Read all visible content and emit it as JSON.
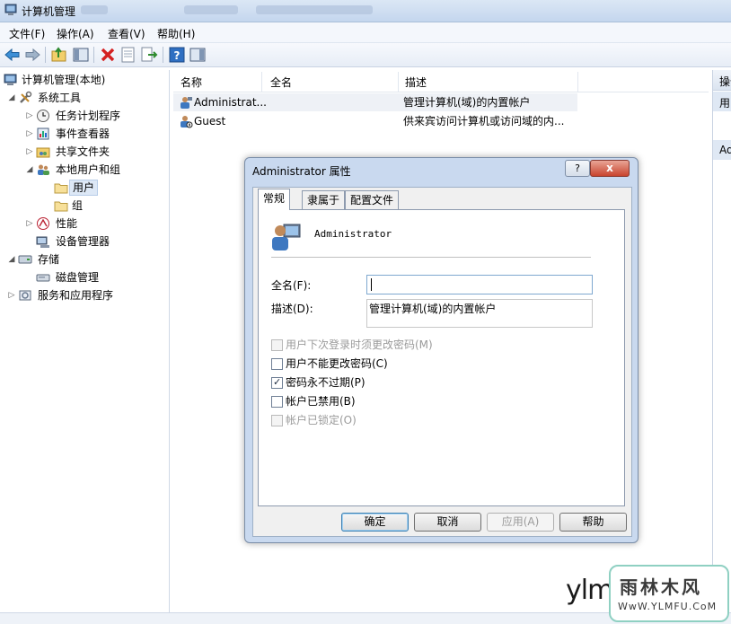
{
  "window": {
    "title": "计算机管理"
  },
  "menubar": {
    "items": [
      "文件(F)",
      "操作(A)",
      "查看(V)",
      "帮助(H)"
    ]
  },
  "toolbar": {
    "buttons": [
      "back-arrow-icon",
      "forward-arrow-icon",
      "up-folder-icon",
      "show-hide-tree-icon",
      "delete-icon",
      "properties-icon",
      "export-list-icon",
      "help-icon",
      "show-action-pane-icon"
    ]
  },
  "tree": {
    "root": "计算机管理(本地)",
    "system_tools": "系统工具",
    "task_scheduler": "任务计划程序",
    "event_viewer": "事件查看器",
    "shared_folders": "共享文件夹",
    "local_users_groups": "本地用户和组",
    "users": "用户",
    "groups": "组",
    "performance": "性能",
    "device_manager": "设备管理器",
    "storage": "存储",
    "disk_management": "磁盘管理",
    "services_apps": "服务和应用程序"
  },
  "list": {
    "columns": [
      "名称",
      "全名",
      "描述"
    ],
    "rows": [
      {
        "name": "Administrat...",
        "full_name": "",
        "desc": "管理计算机(域)的内置帐户"
      },
      {
        "name": "Guest",
        "full_name": "",
        "desc": "供来宾访问计算机或访问域的内..."
      }
    ]
  },
  "actions": {
    "header": "操作",
    "item1": "用",
    "item2": "Ad"
  },
  "dialog": {
    "title": "Administrator 属性",
    "help_btn": "?",
    "close_btn": "x",
    "tabs": [
      "常规",
      "隶属于",
      "配置文件"
    ],
    "username": "Administrator",
    "full_name_label": "全名(F):",
    "full_name_value": "",
    "desc_label": "描述(D):",
    "desc_value": "管理计算机(域)的内置帐户",
    "checkboxes": [
      {
        "label": "用户下次登录时须更改密码(M)",
        "checked": false,
        "enabled": false
      },
      {
        "label": "用户不能更改密码(C)",
        "checked": false,
        "enabled": true
      },
      {
        "label": "密码永不过期(P)",
        "checked": true,
        "enabled": true
      },
      {
        "label": "帐户已禁用(B)",
        "checked": false,
        "enabled": true
      },
      {
        "label": "帐户已锁定(O)",
        "checked": false,
        "enabled": false
      }
    ],
    "buttons": {
      "ok": "确定",
      "cancel": "取消",
      "apply": "应用(A)",
      "help": "帮助"
    }
  },
  "watermark": {
    "text": "ylmf",
    "logo_cn": "雨林木风",
    "logo_url": "WwW.YLMFU.CoM"
  }
}
